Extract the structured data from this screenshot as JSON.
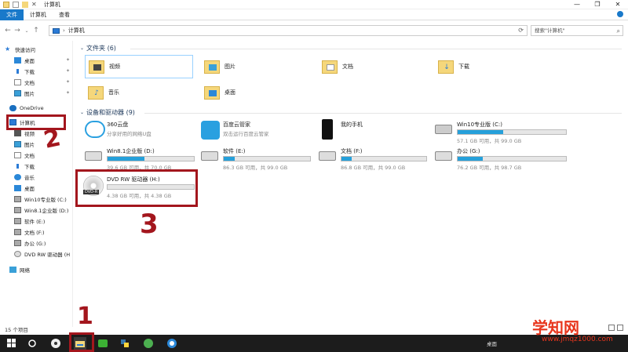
{
  "window": {
    "title": "计算机",
    "controls": [
      "—",
      "❐",
      "✕"
    ]
  },
  "ribbon": {
    "tabs": [
      "文件",
      "计算机",
      "查看"
    ]
  },
  "address": {
    "path": "计算机",
    "search_placeholder": "搜索\"计算机\""
  },
  "nav": {
    "quick_access": "快速访问",
    "quick_items": [
      "桌面",
      "下载",
      "文档",
      "图片"
    ],
    "onedrive": "OneDrive",
    "this_pc": "计算机",
    "pc_items": [
      "视频",
      "图片",
      "文档",
      "下载",
      "音乐",
      "桌面",
      "Win10专业版 (C:)",
      "Win8.1企业版 (D:)",
      "软件 (E:)",
      "文档 (F:)",
      "办公 (G:)",
      "DVD RW 驱动器 (H"
    ],
    "network": "网络"
  },
  "folders": {
    "header": "文件夹 (6)",
    "items": [
      "视频",
      "图片",
      "文档",
      "下载",
      "音乐",
      "桌面"
    ]
  },
  "devices": {
    "header": "设备和驱动器 (9)",
    "apps": [
      {
        "name": "360云盘",
        "sub": "分享好用的网络U盘"
      },
      {
        "name": "百度云管家",
        "sub": "双击运行百度云管家"
      },
      {
        "name": "我的手机",
        "sub": ""
      }
    ],
    "drives": [
      {
        "name": "Win10专业版 (C:)",
        "free": "57.1 GB 可用，共 99.0 GB",
        "used": 0.42
      },
      {
        "name": "Win8.1企业版 (D:)",
        "free": "39.6 GB 可用，共 70.0 GB",
        "used": 0.43
      },
      {
        "name": "软件 (E:)",
        "free": "86.3 GB 可用，共 99.0 GB",
        "used": 0.13
      },
      {
        "name": "文档 (F:)",
        "free": "86.8 GB 可用，共 99.0 GB",
        "used": 0.12
      },
      {
        "name": "办公 (G:)",
        "free": "76.2 GB 可用，共 98.7 GB",
        "used": 0.23
      },
      {
        "name": "DVD RW 驱动器 (H:)",
        "free": "4.38 GB 可用，共 4.38 GB",
        "used": 0.0
      }
    ],
    "dvd_label": "DVD-R"
  },
  "status": {
    "count": "15 个项目"
  },
  "taskbar": {
    "tray_text": "桌面"
  },
  "watermark": {
    "brand": "学知网",
    "url": "www.jmqz1000.com"
  },
  "annotations": [
    "1",
    "2",
    "3"
  ]
}
